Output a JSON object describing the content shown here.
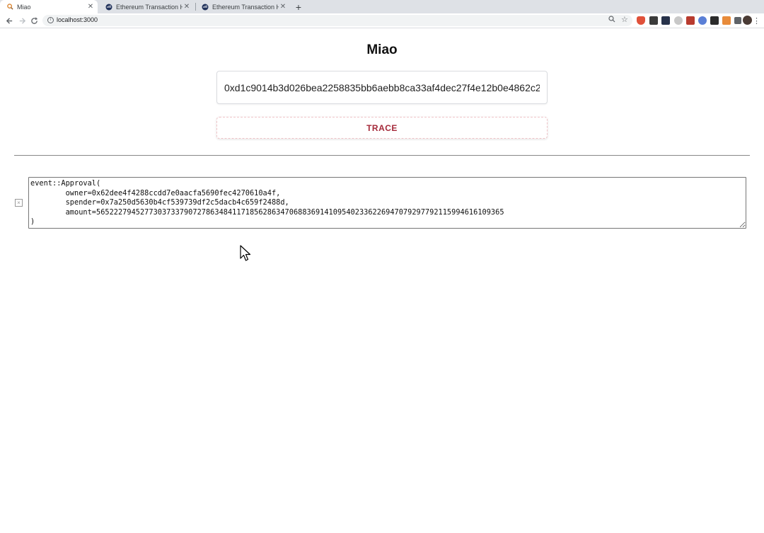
{
  "browser": {
    "tabs": [
      {
        "title": "Miao",
        "active": true
      },
      {
        "title": "Ethereum Transaction Hash",
        "active": false
      },
      {
        "title": "Ethereum Transaction Hash",
        "active": false
      }
    ],
    "url": "localhost:3000",
    "new_tab_symbol": "+"
  },
  "app": {
    "title": "Miao",
    "tx_hash_value": "0xd1c9014b3d026bea2258835bb6aebb8ca33af4dec27f4e12b0e4862c2",
    "trace_label": "TRACE",
    "remove_symbol": "×",
    "result_text": "event::Approval(\n        owner=0x62dee4f4288ccdd7e0aacfa5690fec4270610a4f,\n        spender=0x7a250d5630b4cf539739df2c5dacb4c659f2488d,\n        amount=565222794527730373379072786348411718562863470688369141095402336226947079297792115994616109365\n)"
  },
  "colors": {
    "accent": "#a52a3a",
    "tab_strip": "#dee1e6"
  }
}
